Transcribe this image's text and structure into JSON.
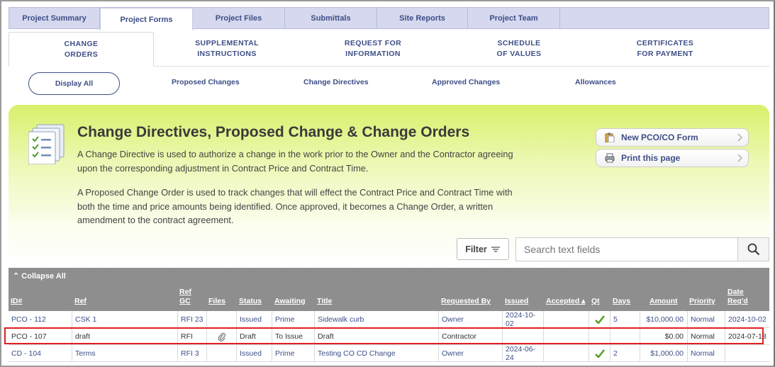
{
  "top_tabs": [
    "Project Summary",
    "Project Forms",
    "Project Files",
    "Submittals",
    "Site Reports",
    "Project Team"
  ],
  "active_top_tab": "Project Forms",
  "sub_tabs": [
    {
      "line1": "CHANGE",
      "line2": "ORDERS"
    },
    {
      "line1": "SUPPLEMENTAL",
      "line2": "INSTRUCTIONS"
    },
    {
      "line1": "REQUEST FOR",
      "line2": "INFORMATION"
    },
    {
      "line1": "SCHEDULE",
      "line2": "OF VALUES"
    },
    {
      "line1": "CERTIFICATES",
      "line2": "FOR PAYMENT"
    }
  ],
  "filters": [
    "Display All",
    "Proposed Changes",
    "Change Directives",
    "Approved Changes",
    "Allowances"
  ],
  "hero": {
    "title": "Change Directives, Proposed Change & Change Orders",
    "p1": "A Change Directive is used to authorize a change in the work prior to the Owner and the Contractor agreeing upon the corresponding adjustment in Contract Price and Contract Time.",
    "p2": "A Proposed Change Order is used to track changes that will effect the Contract Price and Contract Time with both the time and price amounts being identified. Once approved, it becomes a Change Order, a written amendment to the contract agreement.",
    "new_button": "New PCO/CO Form",
    "print_button": "Print this page"
  },
  "filter_button": "Filter",
  "search": {
    "placeholder": "Search text fields"
  },
  "table": {
    "collapse_label": "Collapse All",
    "headers": [
      "ID#",
      "Ref",
      "Ref GC",
      "Files",
      "Status",
      "Awaiting",
      "Title",
      "Requested By",
      "Issued",
      "Accepted",
      "Qt",
      "Days",
      "Amount",
      "Priority",
      "Date Req'd"
    ],
    "rows": [
      {
        "id": "PCO - 112",
        "ref": "CSK 1",
        "ref_gc": "RFI 23",
        "status": "Issued",
        "awaiting": "Prime",
        "title": "Sidewalk curb",
        "requested_by": "Owner",
        "issued": "2024-10-02",
        "accepted": "",
        "days": "5",
        "amount": "$10,000.00",
        "priority": "Normal",
        "date_reqd": "2024-10-02",
        "qt": true,
        "has_file": false
      },
      {
        "id": "PCO - 107",
        "ref": "draft",
        "ref_gc": "RFI",
        "status": "Draft",
        "awaiting": "To Issue",
        "title": "Draft",
        "requested_by": "Contractor",
        "issued": "",
        "accepted": "",
        "days": "",
        "amount": "$0.00",
        "priority": "Normal",
        "date_reqd": "2024-07-18",
        "qt": false,
        "has_file": true
      },
      {
        "id": "CD - 104",
        "ref": "Terms",
        "ref_gc": "RFI 3",
        "status": "Issued",
        "awaiting": "Prime",
        "title": "Testing CO CD Change",
        "requested_by": "Owner",
        "issued": "2024-06-24",
        "accepted": "",
        "days": "2",
        "amount": "$1,000.00",
        "priority": "Normal",
        "date_reqd": "",
        "qt": true,
        "has_file": false
      }
    ]
  },
  "colors": {
    "accent": "#3d4e86",
    "header_bg": "#8e8e8e",
    "highlight": "#e02020",
    "check": "#5aa02c"
  }
}
